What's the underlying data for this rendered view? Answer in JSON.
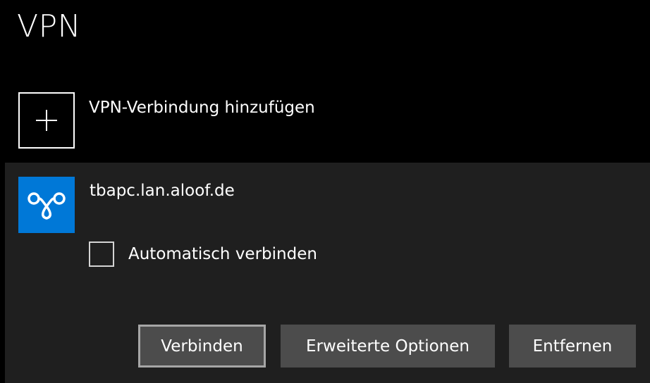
{
  "page": {
    "title": "VPN"
  },
  "add_connection": {
    "icon": "plus-icon",
    "label": "VPN-Verbindung hinzufügen"
  },
  "connection": {
    "icon": "vpn-connection-icon",
    "icon_color": "#0078d7",
    "name": "tbapc.lan.aloof.de",
    "auto_connect": {
      "label": "Automatisch verbinden",
      "checked": false
    },
    "buttons": {
      "connect": "Verbinden",
      "advanced": "Erweiterte Optionen",
      "remove": "Entfernen"
    }
  }
}
